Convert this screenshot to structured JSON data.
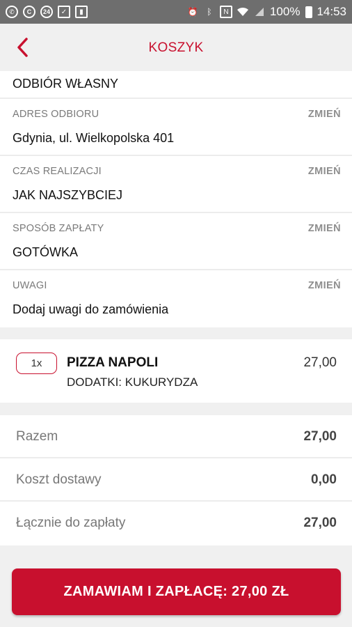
{
  "status_bar": {
    "battery": "100%",
    "time": "14:53",
    "icons_left": [
      "whatsapp-icon",
      "circle-c-icon",
      "24-icon",
      "checklist-icon",
      "battery-saver-icon"
    ],
    "icons_right": [
      "alarm-icon",
      "bluetooth-icon",
      "nfc-icon",
      "wifi-icon",
      "signal-icon",
      "battery-icon"
    ]
  },
  "header": {
    "title": "KOSZYK"
  },
  "pickup": {
    "method": "ODBIÓR WŁASNY",
    "address": {
      "label": "ADRES ODBIORU",
      "value": "Gdynia, ul. Wielkopolska 401",
      "change": "ZMIEŃ"
    },
    "time": {
      "label": "CZAS REALIZACJI",
      "value": "JAK NAJSZYBCIEJ",
      "change": "ZMIEŃ"
    },
    "payment": {
      "label": "SPOSÓB ZAPŁATY",
      "value": "GOTÓWKA",
      "change": "ZMIEŃ"
    },
    "notes": {
      "label": "UWAGI",
      "value": "Dodaj uwagi do zamówienia",
      "change": "ZMIEŃ"
    }
  },
  "cart_item": {
    "quantity": "1x",
    "name": "PIZZA NAPOLI",
    "extras": "DODATKI: KUKURYDZA",
    "price": "27,00"
  },
  "totals": [
    {
      "label": "Razem",
      "value": "27,00"
    },
    {
      "label": "Koszt dostawy",
      "value": "0,00"
    },
    {
      "label": "Łącznie do zapłaty",
      "value": "27,00"
    }
  ],
  "order_button": {
    "label": "ZAMAWIAM I ZAPŁACĘ: 27,00 ZŁ"
  },
  "colors": {
    "accent": "#c8102e",
    "status_bar": "#6e6e6e",
    "background": "#f0f0f0"
  }
}
